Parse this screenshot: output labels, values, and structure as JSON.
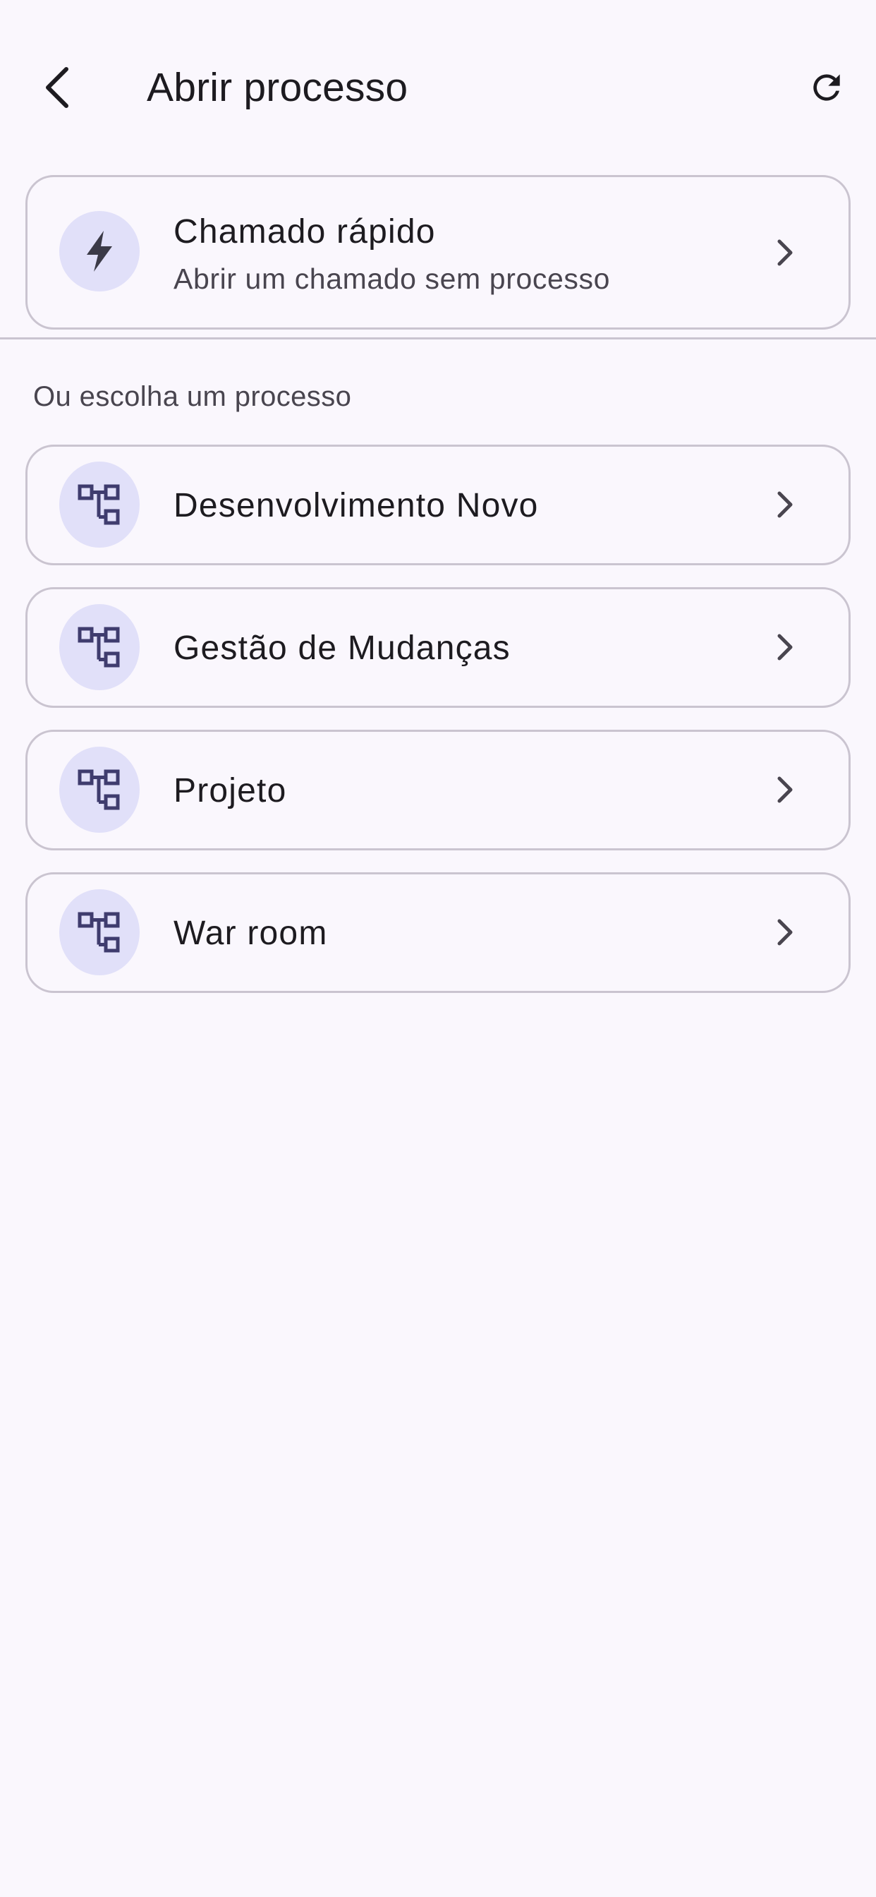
{
  "app_bar": {
    "title": "Abrir processo",
    "back_icon": "arrow-back-icon",
    "refresh_icon": "refresh-icon"
  },
  "quick_call": {
    "title": "Chamado rápido",
    "subtitle": "Abrir um chamado sem processo",
    "icon": "bolt-icon"
  },
  "section": {
    "label": "Ou escolha um processo"
  },
  "processes": [
    {
      "label": "Desenvolvimento Novo",
      "icon": "account-tree-icon"
    },
    {
      "label": "Gestão de Mudanças",
      "icon": "account-tree-icon"
    },
    {
      "label": "Projeto",
      "icon": "account-tree-icon"
    },
    {
      "label": "War room",
      "icon": "account-tree-icon"
    }
  ],
  "colors": {
    "background": "#FAF7FD",
    "card_border": "#CAC4D0",
    "avatar_bg": "#E1E0F9",
    "icon_color": "#3F3C6E",
    "text_primary": "#1D1B20",
    "text_secondary": "#49454F"
  }
}
